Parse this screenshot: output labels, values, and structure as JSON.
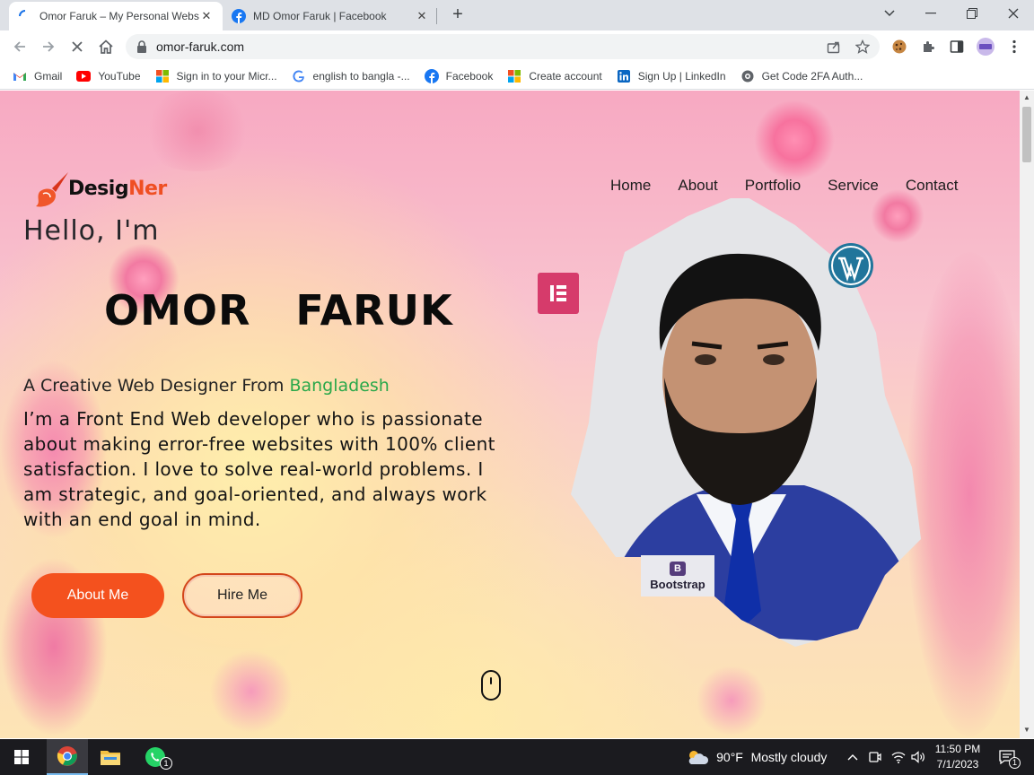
{
  "browser": {
    "tabs": [
      {
        "title": "Omor Faruk – My Personal Websi",
        "close": "✕"
      },
      {
        "title": "MD Omor Faruk | Facebook",
        "close": "✕"
      }
    ],
    "new_tab": "+",
    "url": "omor-faruk.com",
    "bookmarks": [
      {
        "label": "Gmail",
        "icon": "gmail-icon"
      },
      {
        "label": "YouTube",
        "icon": "youtube-icon"
      },
      {
        "label": "Sign in to your Micr...",
        "icon": "microsoft-icon"
      },
      {
        "label": "english to bangla -...",
        "icon": "google-icon"
      },
      {
        "label": "Facebook",
        "icon": "facebook-icon"
      },
      {
        "label": "Create account",
        "icon": "microsoft-icon"
      },
      {
        "label": "Sign Up | LinkedIn",
        "icon": "linkedin-icon"
      },
      {
        "label": "Get Code 2FA Auth...",
        "icon": "authenticator-icon"
      }
    ]
  },
  "site": {
    "logo": {
      "part1": "Desig",
      "part2": "Ner"
    },
    "nav": [
      "Home",
      "About",
      "Portfolio",
      "Service",
      "Contact"
    ],
    "hello": "Hello, I'm",
    "name": "OMOR  FARUK",
    "tagline_prefix": "A Creative Web Designer From ",
    "tagline_country": "Bangladesh",
    "bio": "I’m a Front End Web developer who is passionate about making error-free websites with 100% client satisfaction. I love to solve real-world problems. I am strategic, and goal-oriented, and always work with an end goal in mind.",
    "buttons": {
      "about": "About Me",
      "hire": "Hire Me"
    },
    "badges": {
      "bootstrap": "Bootstrap",
      "bootstrap_letter": "B"
    },
    "colors": {
      "accent": "#f4511e",
      "country": "#2aa84a",
      "elementor": "#d63b6b",
      "wordpress": "#21759b",
      "bootstrap": "#563d7c"
    }
  },
  "taskbar": {
    "weather_temp": "90°F",
    "weather_text": "Mostly cloudy",
    "time": "11:50 PM",
    "date": "7/1/2023",
    "whatsapp_badge": "1",
    "notification_badge": "1"
  }
}
